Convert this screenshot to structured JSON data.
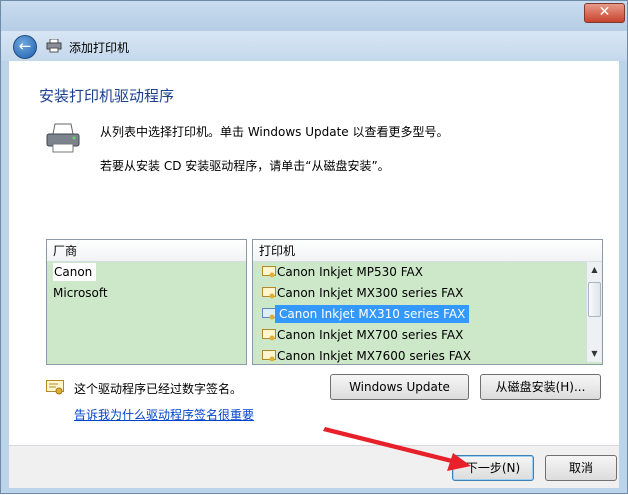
{
  "titlebar": {
    "close_label": "✕"
  },
  "address_bar": {
    "title": "添加打印机"
  },
  "heading": "安装打印机驱动程序",
  "description_1": "从列表中选择打印机。单击 Windows Update 以查看更多型号。",
  "description_2": "若要从安装 CD 安装驱动程序，请单击“从磁盘安装”。",
  "manufacturers": {
    "header": "厂商",
    "items": [
      "Canon",
      "Microsoft"
    ],
    "selected": "Canon"
  },
  "printers": {
    "header": "打印机",
    "items": [
      "Canon Inkjet MP530 FAX",
      "Canon Inkjet MX300 series FAX",
      "Canon Inkjet MX310 series FAX",
      "Canon Inkjet MX700 series FAX",
      "Canon Inkjet MX7600 series FAX"
    ],
    "selected": "Canon Inkjet MX310 series FAX"
  },
  "buttons": {
    "windows_update": "Windows Update",
    "have_disk": "从磁盘安装(H)...",
    "next": "下一步(N)",
    "cancel": "取消"
  },
  "signature_note": "这个驱动程序已经过数字签名。",
  "signature_link": "告诉我为什么驱动程序签名很重要",
  "colors": {
    "list_bg": "#cde8c8",
    "selection": "#3399ff",
    "heading": "#1e3f8f",
    "annotation_arrow": "#e8202a"
  }
}
